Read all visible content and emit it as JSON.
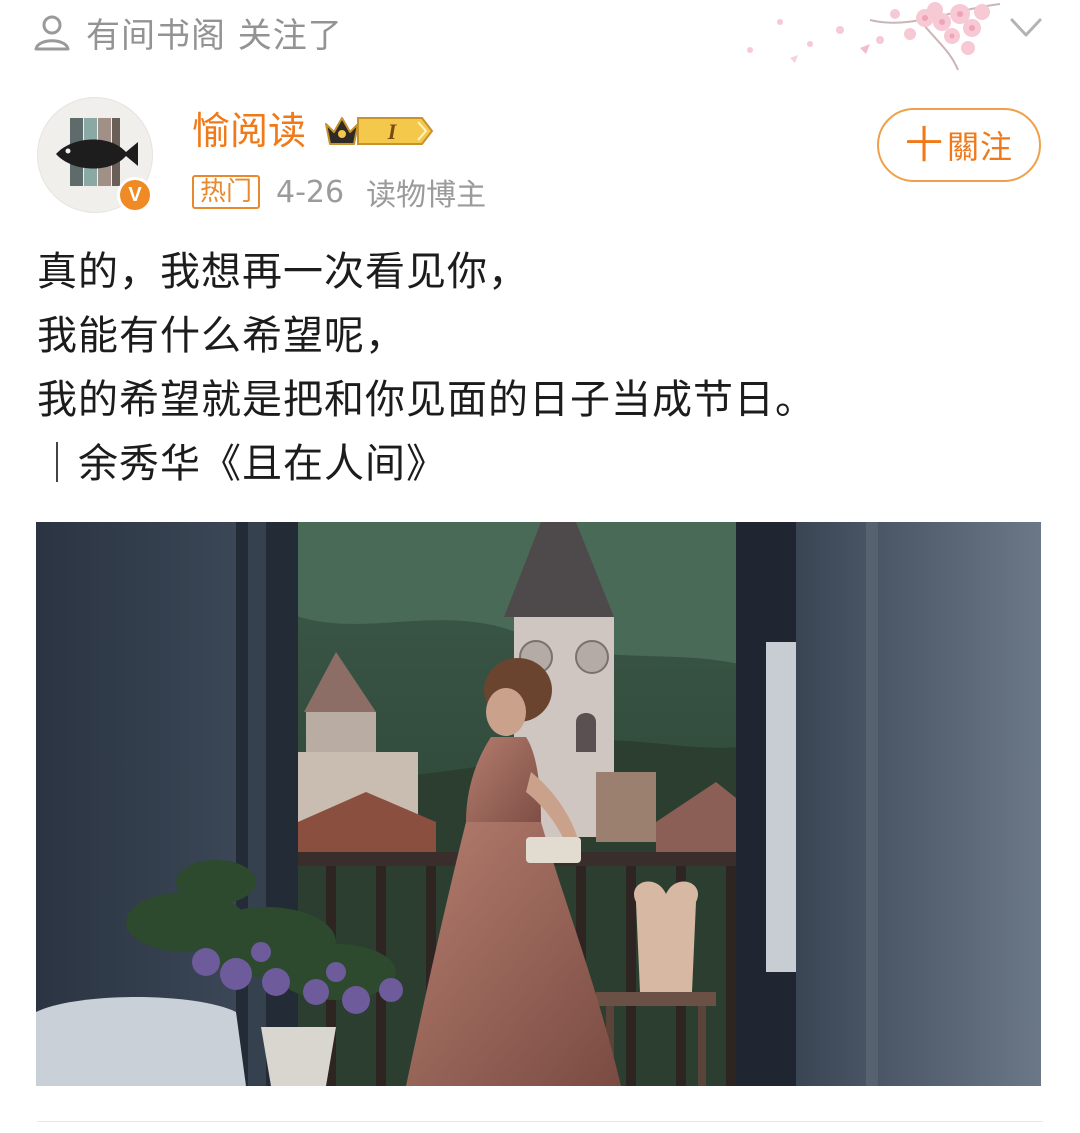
{
  "header": {
    "followed_text": "有间书阁 关注了",
    "icons": {
      "person": "person-icon",
      "expand": "chevron-down-icon",
      "decoration": "cherry-blossom-decoration"
    }
  },
  "author": {
    "name": "愉阅读",
    "vip_level": "I",
    "verified_mark": "V",
    "hot_tag": "热门",
    "date": "4-26",
    "source": "读物博主",
    "follow_plus": "十",
    "follow_label": "關注"
  },
  "post": {
    "lines": [
      "真的，我想再一次看见你，",
      "我能有什么希望呢，",
      "我的希望就是把和你见面的日子当成节日。",
      "｜余秀华《且在人间》"
    ],
    "image_subject": "woman-in-pink-dress-at-balcony-window"
  },
  "colors": {
    "accent_orange": "#f07a1a",
    "follow_border": "#f0a04a",
    "text_primary": "#1c1c1c",
    "text_meta": "#9b9b9b"
  }
}
